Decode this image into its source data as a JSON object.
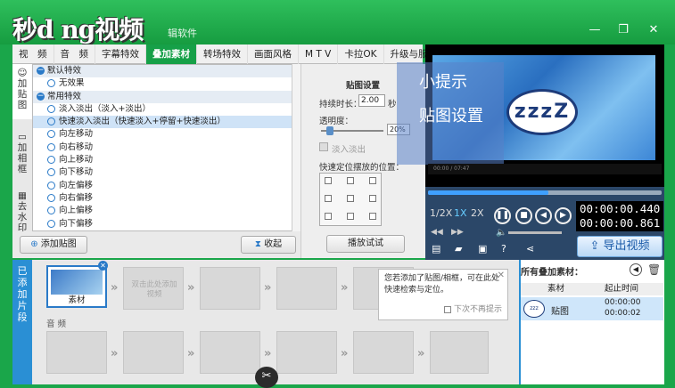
{
  "app": {
    "logo_text": "秒d ng视频",
    "app_name": "辑软件",
    "window_buttons": [
      "minimize-icon",
      "restore-icon",
      "close-icon"
    ]
  },
  "tabs": [
    "视　频",
    "音　频",
    "字幕特效",
    "叠加素材",
    "转场特效",
    "画面风格",
    "M T V",
    "卡拉OK",
    "升级与服务"
  ],
  "active_tab": "叠加素材",
  "side_tabs": [
    "加贴图",
    "加相框",
    "去水印"
  ],
  "effects": {
    "categories": [
      {
        "name": "默认特效",
        "items": [
          "无效果"
        ]
      },
      {
        "name": "常用特效",
        "items": [
          "淡入淡出（淡入+淡出）",
          "快速淡入淡出（快速淡入+停留+快速淡出）",
          "向左移动",
          "向右移动",
          "向上移动",
          "向下移动",
          "向左偏移",
          "向右偏移",
          "向上偏移",
          "向下偏移"
        ]
      }
    ],
    "selected": "快速淡入淡出（快速淡入+停留+快速淡出）"
  },
  "left_buttons": {
    "add": "添加贴图",
    "collapse": "收起"
  },
  "settings": {
    "title": "贴图设置",
    "duration_label": "持续时长：",
    "duration_value": "2.00",
    "duration_unit": "秒",
    "opacity_label": "透明度：",
    "opacity_value": "20%",
    "fade_label": "淡入淡出",
    "position_label": "快速定位摆放的位置：",
    "preview_button": "播放试试"
  },
  "preview": {
    "tip_title": "小提示",
    "tip_sub": "贴图设置",
    "bubble_text": "zzzZ",
    "mini_time": "00:00 / 07:47"
  },
  "controls": {
    "speeds": [
      "1/2X",
      "1X",
      "2X"
    ],
    "time_current": "00:00:00.440",
    "time_total": "00:00:00.861",
    "export_label": "导出视频",
    "seek_progress": 0.5
  },
  "timeline": {
    "label": "已添加片段",
    "first_clip_label": "素材",
    "placeholder": "双击此处添加视频",
    "audio_label": "音 频"
  },
  "popup": {
    "text": "您若添加了贴图/相框，可在此处快速检索与定位。",
    "checkbox": "下次不再提示"
  },
  "assets": {
    "title": "所有叠加素材：",
    "col_material": "素材",
    "col_time": "起止时间",
    "row_name": "贴图",
    "row_start": "00:00:00",
    "row_end": "00:00:02"
  }
}
